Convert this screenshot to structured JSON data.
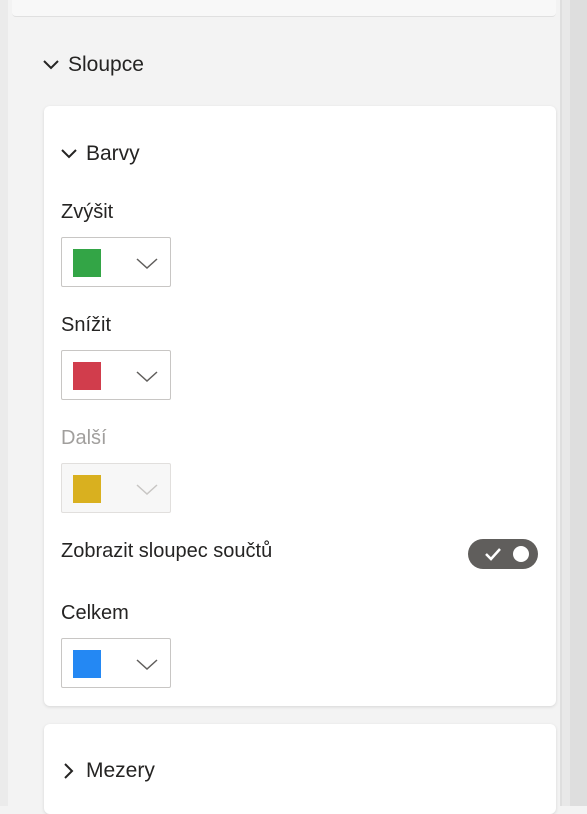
{
  "section": {
    "title": "Sloupce",
    "expanded": true
  },
  "colors_card": {
    "title": "Barvy",
    "expanded": true,
    "increase": {
      "label": "Zvýšit",
      "color": "#33a546"
    },
    "decrease": {
      "label": "Snížit",
      "color": "#d13d4c"
    },
    "other": {
      "label": "Další",
      "color": "#d9b01f",
      "disabled": true
    },
    "totals_toggle": {
      "label": "Zobrazit sloupec součtů",
      "on": true
    },
    "total": {
      "label": "Celkem",
      "color": "#2488f3"
    }
  },
  "gap_card": {
    "title": "Mezery",
    "expanded": false
  },
  "icons": {
    "section_chevron": "chevron-down-icon",
    "colors_chevron": "chevron-down-icon",
    "picker_caret": "chevron-down-icon",
    "toggle_check": "check-icon",
    "gap_chevron": "chevron-right-icon"
  }
}
